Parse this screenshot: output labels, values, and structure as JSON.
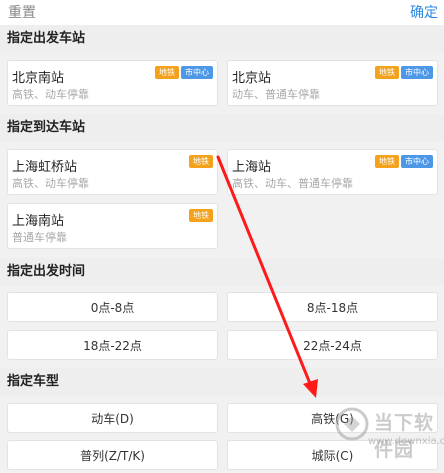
{
  "topbar": {
    "reset": "重置",
    "confirm": "确定"
  },
  "sections": {
    "departure": "指定出发车站",
    "arrival": "指定到达车站",
    "time": "指定出发时间",
    "type": "指定车型"
  },
  "departure_stations": [
    {
      "name": "北京南站",
      "desc": "高铁、动车停靠",
      "badges": [
        "地铁",
        "市中心"
      ]
    },
    {
      "name": "北京站",
      "desc": "动车、普通车停靠",
      "badges": [
        "地铁",
        "市中心"
      ]
    }
  ],
  "arrival_stations": [
    {
      "name": "上海虹桥站",
      "desc": "高铁、动车停靠",
      "badges": [
        "地铁"
      ]
    },
    {
      "name": "上海站",
      "desc": "高铁、动车、普通车停靠",
      "badges": [
        "地铁",
        "市中心"
      ]
    },
    {
      "name": "上海南站",
      "desc": "普通车停靠",
      "badges": [
        "地铁"
      ]
    }
  ],
  "times": [
    "0点-8点",
    "8点-18点",
    "18点-22点",
    "22点-24点"
  ],
  "train_types": [
    "动车(D)",
    "高铁(G)",
    "普列(Z/T/K)",
    "城际(C)"
  ],
  "watermark": {
    "text": "当下软件园",
    "url": "www.downxia.com"
  },
  "colors": {
    "accent": "#2b89e4",
    "metro_badge": "#f4a21c",
    "center_badge": "#4c98e6",
    "arrow": "#ff1a1a"
  }
}
